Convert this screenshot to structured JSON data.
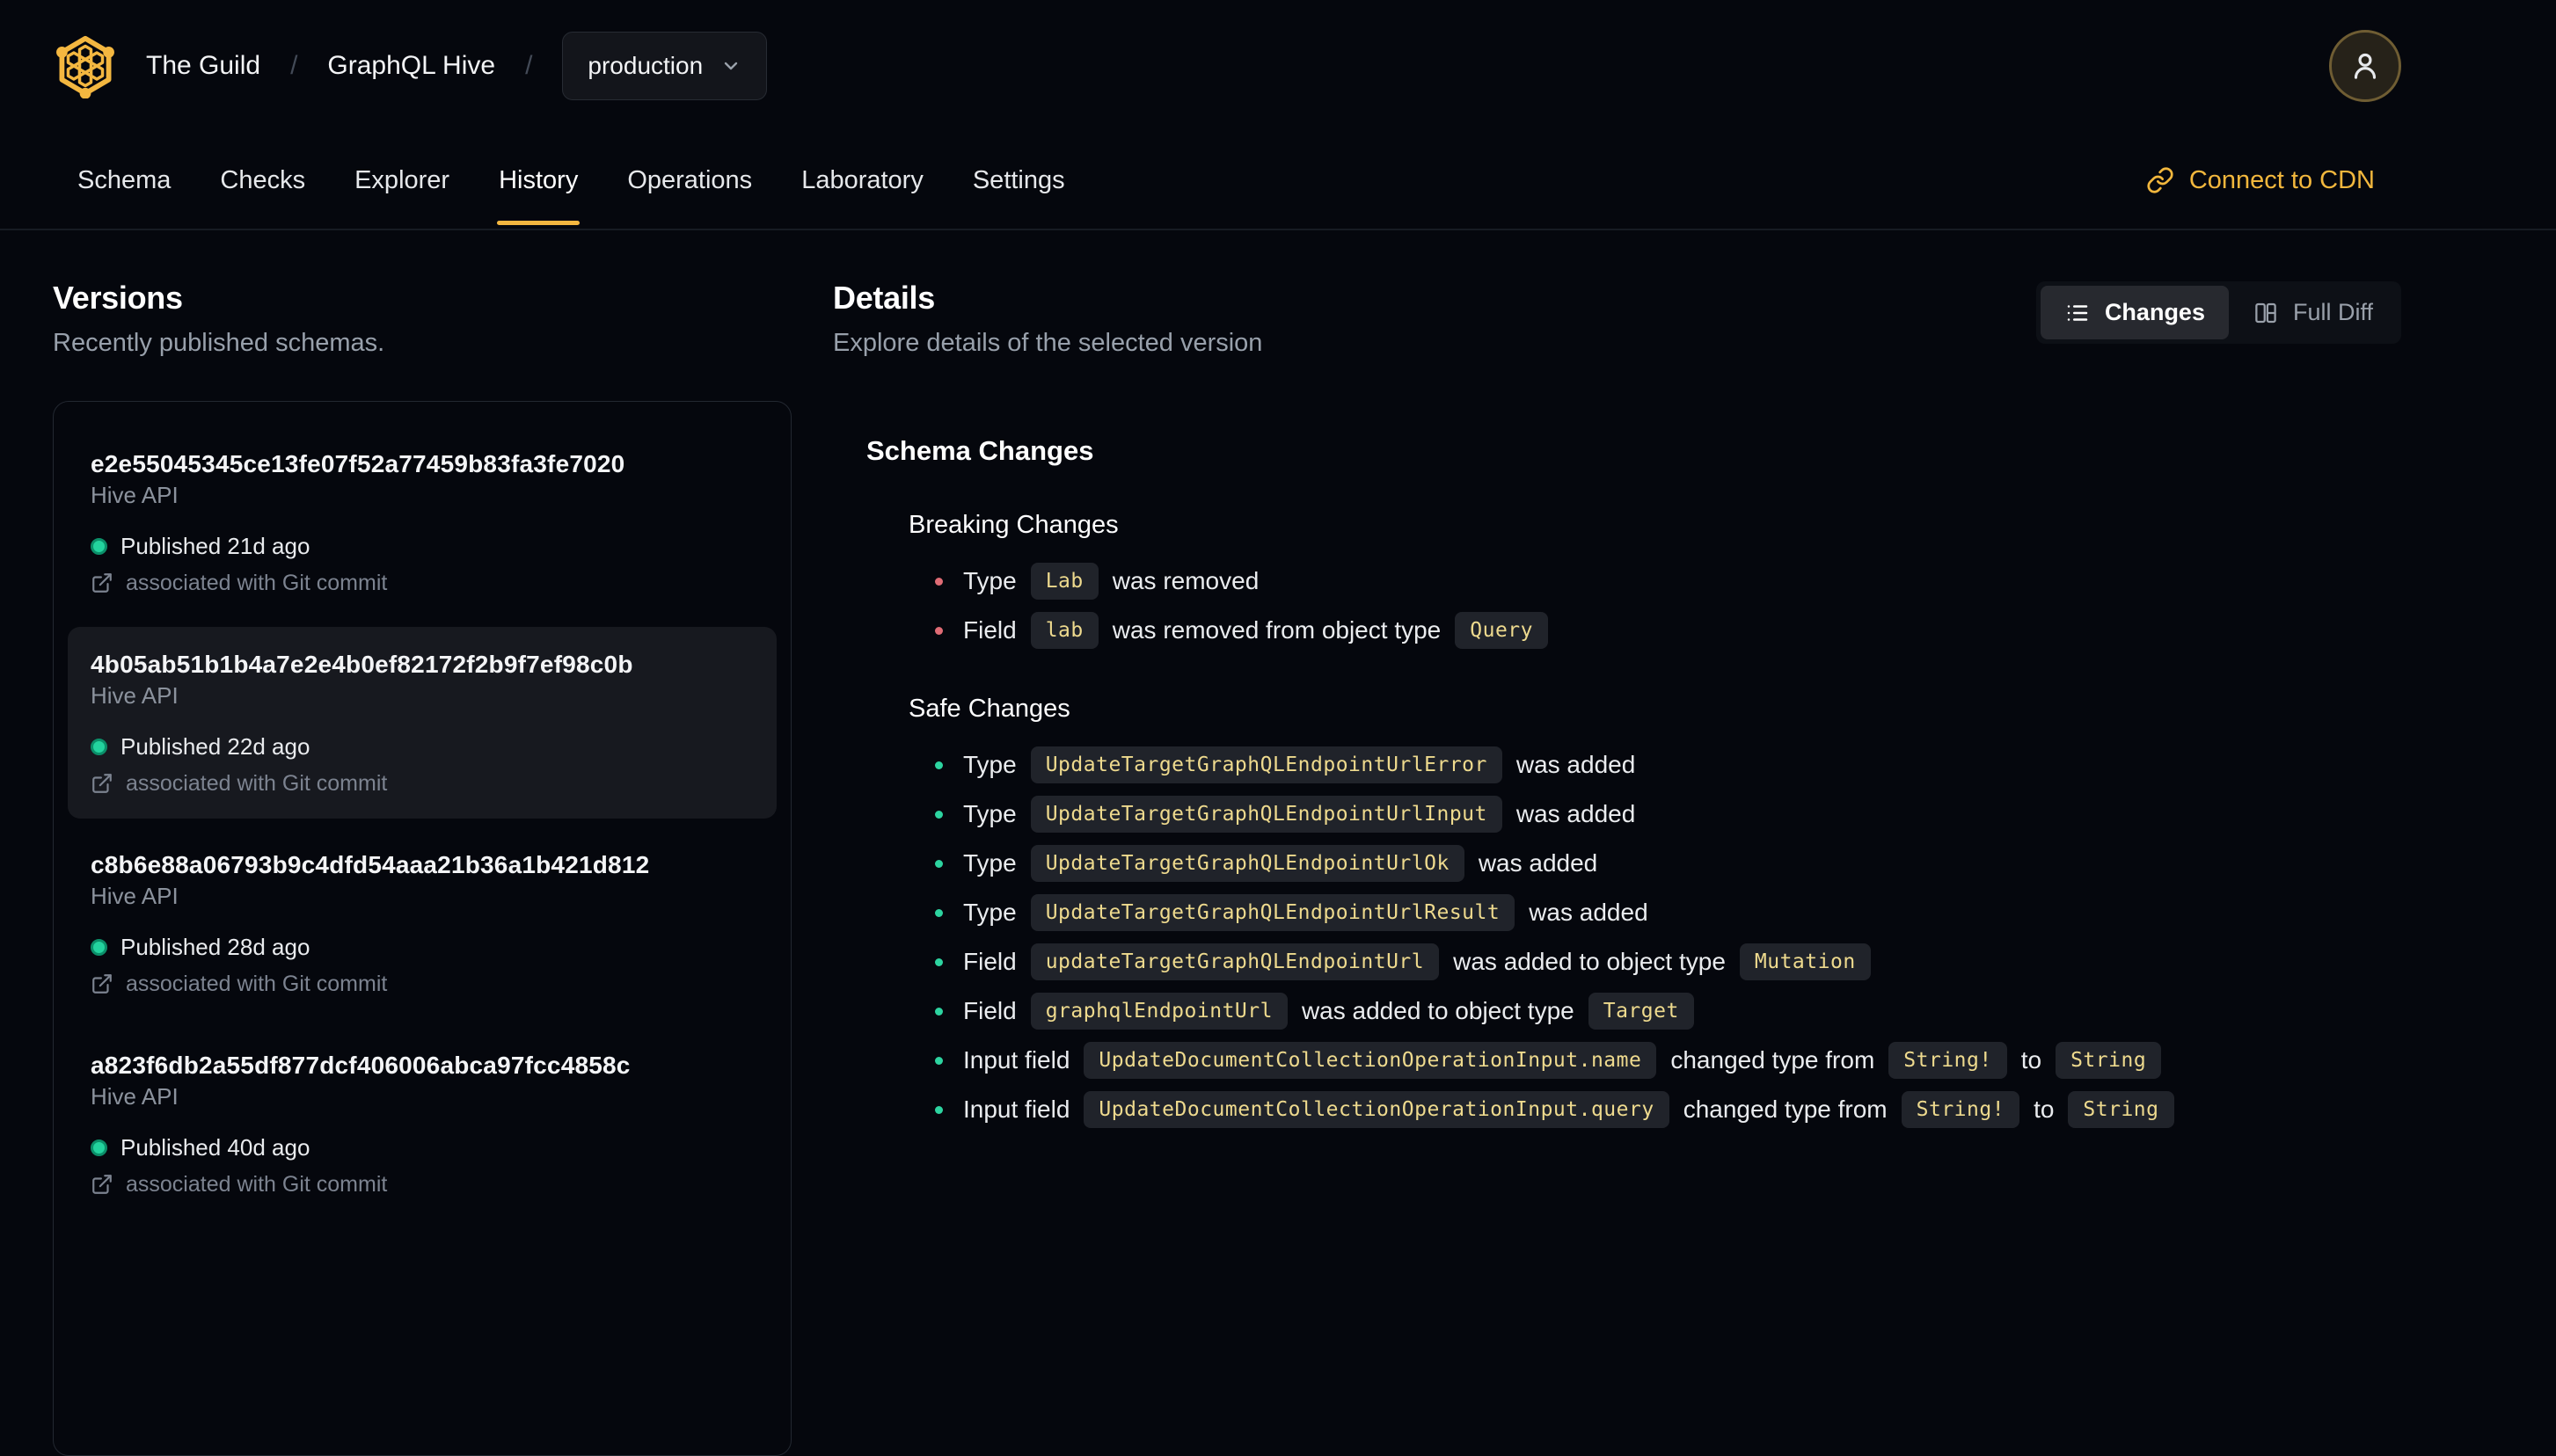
{
  "header": {
    "org": "The Guild",
    "project": "GraphQL Hive",
    "breadcrumb_separator": "/",
    "target_selector": {
      "value": "production"
    }
  },
  "nav": {
    "tabs": [
      {
        "label": "Schema",
        "active": false
      },
      {
        "label": "Checks",
        "active": false
      },
      {
        "label": "Explorer",
        "active": false
      },
      {
        "label": "History",
        "active": true
      },
      {
        "label": "Operations",
        "active": false
      },
      {
        "label": "Laboratory",
        "active": false
      },
      {
        "label": "Settings",
        "active": false
      }
    ],
    "cdn_link": {
      "label": "Connect to CDN"
    }
  },
  "versions": {
    "title": "Versions",
    "subtitle": "Recently published schemas.",
    "items": [
      {
        "hash": "e2e55045345ce13fe07f52a77459b83fa3fe7020",
        "service": "Hive API",
        "published": "Published 21d ago",
        "commit_note": "associated with Git commit",
        "selected": false
      },
      {
        "hash": "4b05ab51b1b4a7e2e4b0ef82172f2b9f7ef98c0b",
        "service": "Hive API",
        "published": "Published 22d ago",
        "commit_note": "associated with Git commit",
        "selected": true
      },
      {
        "hash": "c8b6e88a06793b9c4dfd54aaa21b36a1b421d812",
        "service": "Hive API",
        "published": "Published 28d ago",
        "commit_note": "associated with Git commit",
        "selected": false
      },
      {
        "hash": "a823f6db2a55df877dcf406006abca97fcc4858c",
        "service": "Hive API",
        "published": "Published 40d ago",
        "commit_note": "associated with Git commit",
        "selected": false
      }
    ]
  },
  "details": {
    "title": "Details",
    "subtitle": "Explore details of the selected version",
    "view_toggle": {
      "changes_label": "Changes",
      "full_diff_label": "Full Diff",
      "active": "Changes"
    },
    "schema_changes": {
      "title": "Schema Changes",
      "sections": [
        {
          "title": "Breaking Changes",
          "severity": "breaking",
          "items": [
            [
              {
                "t": "text",
                "v": "Type"
              },
              {
                "t": "code",
                "v": "Lab"
              },
              {
                "t": "text",
                "v": "was removed"
              }
            ],
            [
              {
                "t": "text",
                "v": "Field"
              },
              {
                "t": "code",
                "v": "lab"
              },
              {
                "t": "text",
                "v": "was removed from object type"
              },
              {
                "t": "code",
                "v": "Query"
              }
            ]
          ]
        },
        {
          "title": "Safe Changes",
          "severity": "safe",
          "items": [
            [
              {
                "t": "text",
                "v": "Type"
              },
              {
                "t": "code",
                "v": "UpdateTargetGraphQLEndpointUrlError"
              },
              {
                "t": "text",
                "v": "was added"
              }
            ],
            [
              {
                "t": "text",
                "v": "Type"
              },
              {
                "t": "code",
                "v": "UpdateTargetGraphQLEndpointUrlInput"
              },
              {
                "t": "text",
                "v": "was added"
              }
            ],
            [
              {
                "t": "text",
                "v": "Type"
              },
              {
                "t": "code",
                "v": "UpdateTargetGraphQLEndpointUrlOk"
              },
              {
                "t": "text",
                "v": "was added"
              }
            ],
            [
              {
                "t": "text",
                "v": "Type"
              },
              {
                "t": "code",
                "v": "UpdateTargetGraphQLEndpointUrlResult"
              },
              {
                "t": "text",
                "v": "was added"
              }
            ],
            [
              {
                "t": "text",
                "v": "Field"
              },
              {
                "t": "code",
                "v": "updateTargetGraphQLEndpointUrl"
              },
              {
                "t": "text",
                "v": "was added to object type"
              },
              {
                "t": "code",
                "v": "Mutation"
              }
            ],
            [
              {
                "t": "text",
                "v": "Field"
              },
              {
                "t": "code",
                "v": "graphqlEndpointUrl"
              },
              {
                "t": "text",
                "v": "was added to object type"
              },
              {
                "t": "code",
                "v": "Target"
              }
            ],
            [
              {
                "t": "text",
                "v": "Input field"
              },
              {
                "t": "code",
                "v": "UpdateDocumentCollectionOperationInput.name"
              },
              {
                "t": "text",
                "v": "changed type from"
              },
              {
                "t": "code",
                "v": "String!"
              },
              {
                "t": "text",
                "v": "to"
              },
              {
                "t": "code",
                "v": "String"
              }
            ],
            [
              {
                "t": "text",
                "v": "Input field"
              },
              {
                "t": "code",
                "v": "UpdateDocumentCollectionOperationInput.query"
              },
              {
                "t": "text",
                "v": "changed type from"
              },
              {
                "t": "code",
                "v": "String!"
              },
              {
                "t": "text",
                "v": "to"
              },
              {
                "t": "code",
                "v": "String"
              }
            ]
          ]
        }
      ]
    }
  },
  "colors": {
    "accent": "#f4b740",
    "page_bg": "#05070d",
    "breaking_bullet": "#e06c75",
    "safe_bullet": "#2dd4a0",
    "published_dot": "#23d39e",
    "code_chip_bg": "#20232a",
    "code_chip_text": "#eeda8e",
    "selected_item_bg": "#17191f"
  }
}
